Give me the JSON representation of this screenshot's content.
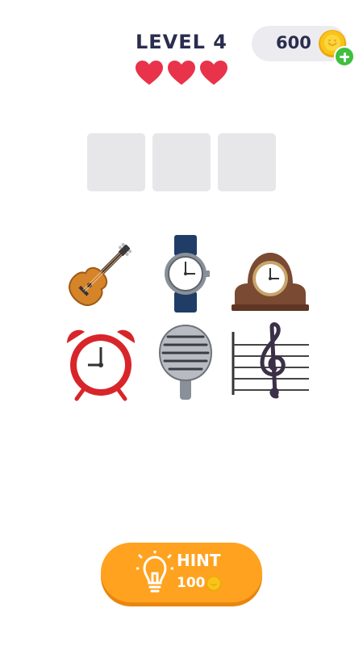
{
  "header": {
    "level_label": "LEVEL 4",
    "lives": 3,
    "coins": "600"
  },
  "answer": {
    "slot_count": 3
  },
  "tiles": [
    {
      "name": "guitar"
    },
    {
      "name": "wristwatch"
    },
    {
      "name": "mantelpiece-clock"
    },
    {
      "name": "alarm-clock"
    },
    {
      "name": "microphone"
    },
    {
      "name": "musical-score"
    }
  ],
  "hint": {
    "label": "HINT",
    "cost": "100"
  },
  "colors": {
    "heart": "#e8334a",
    "hint_button": "#ffa21f",
    "coin": "#f9c417",
    "plus": "#3fbf3f",
    "text": "#2a2d4e"
  }
}
